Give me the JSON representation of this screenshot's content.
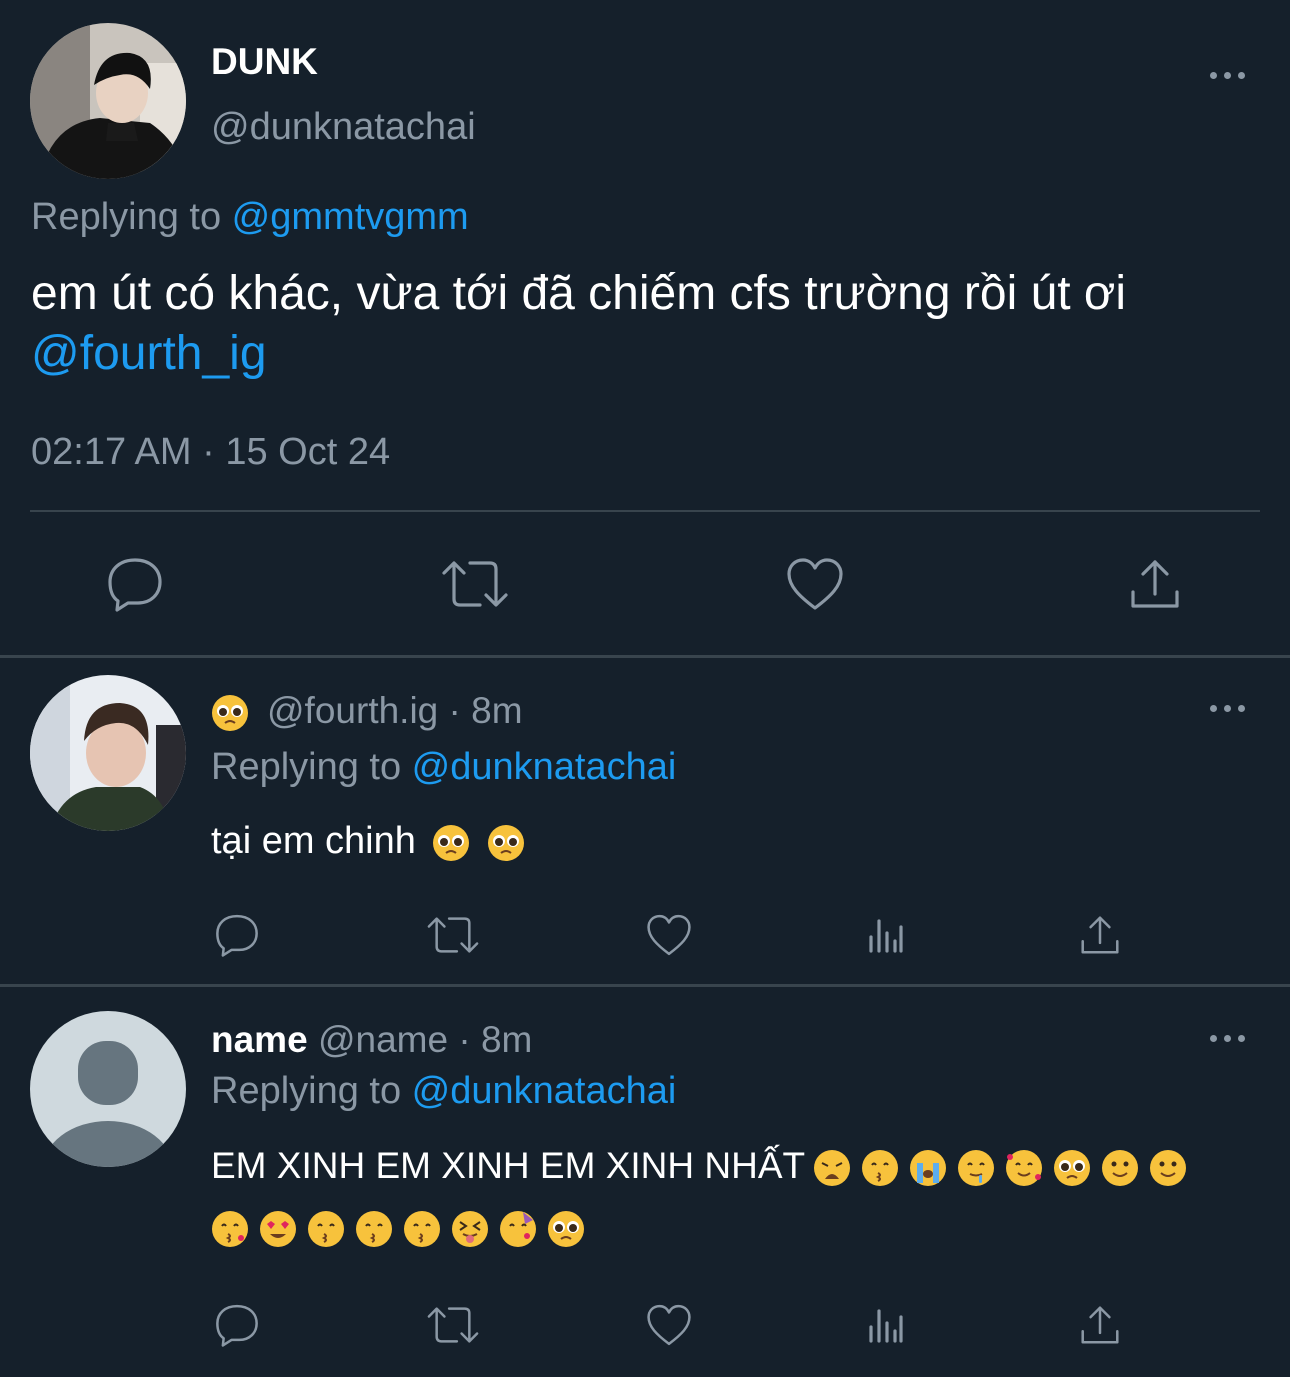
{
  "main_tweet": {
    "display_name": "DUNK",
    "handle": "@dunknatachai",
    "replying_prefix": "Replying to ",
    "replying_handle": "@gmmtvgmm",
    "text": "em út có khác, vừa tới đã chiếm cfs trường rồi út ơi",
    "mention": "@fourth_ig",
    "timestamp": "02:17 AM · 15 Oct 24",
    "actions": [
      "reply",
      "retweet",
      "like",
      "share"
    ]
  },
  "replies": [
    {
      "display_name_emoji": "pleading-face",
      "handle": "@fourth.ig",
      "time": "· 8m",
      "replying_prefix": "Replying to ",
      "replying_handle": "@dunknatachai",
      "text": "tại em chinh",
      "emojis": [
        "pleading-face",
        "pleading-face"
      ],
      "actions": [
        "reply",
        "retweet",
        "like",
        "views",
        "share"
      ]
    },
    {
      "display_name": "name",
      "handle": "@name",
      "time": "· 8m",
      "replying_prefix": "Replying to ",
      "replying_handle": "@dunknatachai",
      "text": "EM XINH EM XINH EM XINH NHẤT",
      "emojis_line1": [
        "weary-face",
        "kissing-smiling-eyes-face",
        "loudly-crying-face",
        "drooling-face",
        "smiling-face-with-hearts",
        "pleading-face",
        "smiling-face",
        "slightly-smiling-face"
      ],
      "emojis_line2": [
        "face-blowing-kiss",
        "heart-eyes-face",
        "kissing-smiling-eyes-face",
        "kissing-face-with-smiling-eyes",
        "kissing-face",
        "squinting-tongue-face",
        "partying-face",
        "face-holding-back-tears"
      ],
      "actions": [
        "reply",
        "retweet",
        "like",
        "views",
        "share"
      ]
    }
  ],
  "colors": {
    "background": "#15202b",
    "text": "#ffffff",
    "muted": "#8b98a5",
    "link": "#1d9bf0",
    "divider": "#38444d",
    "emoji": "#f7c23c"
  }
}
